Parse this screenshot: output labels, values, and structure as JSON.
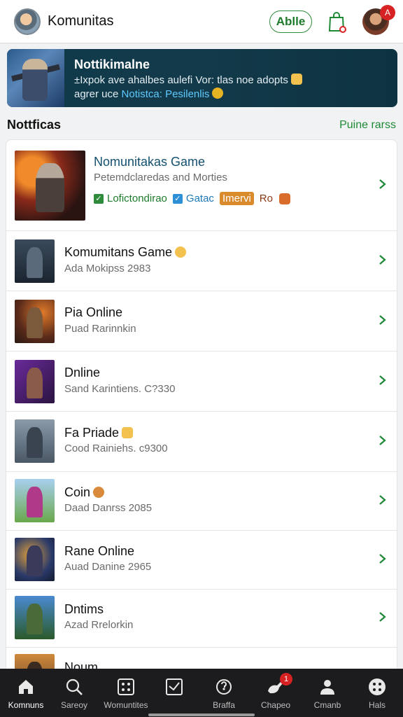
{
  "header": {
    "title": "Komunitas",
    "action_label": "Ablle",
    "profile_badge": "A"
  },
  "banner": {
    "title": "Nottikimalne",
    "line1": "±Ixpok ave ahalbes aulefi Vor: tlas noe adopts",
    "line2_prefix": "agrer uce",
    "line2_link": "Notistca: Pesilenlis"
  },
  "section": {
    "title": "Nottficas",
    "link": "Puine rarss"
  },
  "featured": {
    "name": "Nomunitakas Game",
    "subtitle": "Petemdclaredas and Morties",
    "tags": [
      "Lofictondirao",
      "Gatac",
      "Imervi",
      "Ro"
    ]
  },
  "items": [
    {
      "name": "Komumitans Game",
      "sub": "Ada Mokipss 2983"
    },
    {
      "name": "Pia Online",
      "sub": "Puad Rarinnkin"
    },
    {
      "name": "Dnline",
      "sub": "Sand Karintiens. C?330"
    },
    {
      "name": "Fa Priade",
      "sub": "Cood Rainiehs. c9300"
    },
    {
      "name": "Coin",
      "sub": "Daad Danrss 2085"
    },
    {
      "name": "Rane Online",
      "sub": "Auad Danine 2965"
    },
    {
      "name": "Dntims",
      "sub": "Azad Rrelorkin"
    },
    {
      "name": "Noum",
      "sub": ""
    }
  ],
  "nav": [
    {
      "label": "Komnuns",
      "icon": "home-icon"
    },
    {
      "label": "Sareoy",
      "icon": "search-icon"
    },
    {
      "label": "Womuntites",
      "icon": "grid-icon"
    },
    {
      "label": "",
      "icon": "chart-icon"
    },
    {
      "label": "Braffa",
      "icon": "circle-icon"
    },
    {
      "label": "Chapeo",
      "icon": "chat-icon",
      "badge": "1"
    },
    {
      "label": "Cmanb",
      "icon": "person-icon"
    },
    {
      "label": "Hals",
      "icon": "dots-icon"
    }
  ]
}
